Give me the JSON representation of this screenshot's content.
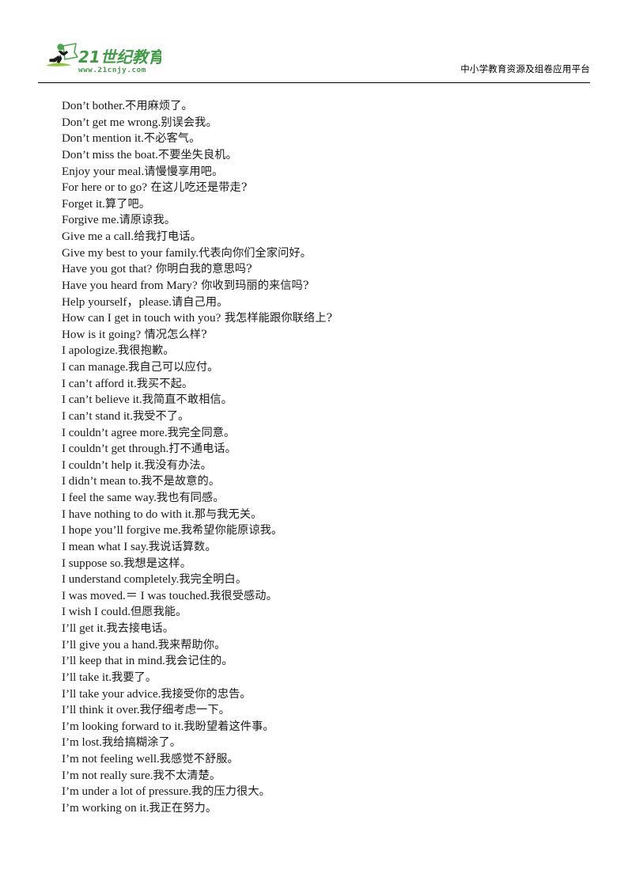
{
  "header": {
    "logo": {
      "icon": "running-person-with-flag-icon",
      "brand_text": "21世纪教育",
      "brand_url": "www.21cnjy.com",
      "green": "#3f9c45",
      "dark_green": "#2e7d33",
      "light_green": "#8cc63f"
    },
    "tagline": "中小学教育资源及组卷应用平台"
  },
  "content": {
    "lines": [
      {
        "en": "Don’t bother.",
        "zh": "不用麻烦了。"
      },
      {
        "en": "Don’t get me wrong.",
        "zh": "别误会我。"
      },
      {
        "en": "Don’t mention it.",
        "zh": "不必客气。"
      },
      {
        "en": "Don’t miss the boat.",
        "zh": "不要坐失良机。"
      },
      {
        "en": "Enjoy your meal.",
        "zh": "请慢慢享用吧。"
      },
      {
        "en": "For here or to go?",
        "zh": " 在这儿吃还是带走?"
      },
      {
        "en": "Forget it.",
        "zh": "算了吧。"
      },
      {
        "en": "Forgive me.",
        "zh": "请原谅我。"
      },
      {
        "en": "Give me a call.",
        "zh": "给我打电话。"
      },
      {
        "en": "Give my best to your family.",
        "zh": "代表向你们全家问好。"
      },
      {
        "en": "Have you got that?",
        "zh": " 你明白我的意思吗?"
      },
      {
        "en": "Have you heard from Mary?",
        "zh": " 你收到玛丽的来信吗?"
      },
      {
        "en": "Help yourself，please.",
        "zh": "请自己用。"
      },
      {
        "en": "How can I get in touch with you?",
        "zh": " 我怎样能跟你联络上?"
      },
      {
        "en": "How is it going?",
        "zh": " 情况怎么样?"
      },
      {
        "en": "I apologize.",
        "zh": "我很抱歉。"
      },
      {
        "en": "I can manage.",
        "zh": "我自己可以应付。"
      },
      {
        "en": "I can’t afford it.",
        "zh": "我买不起。"
      },
      {
        "en": "I can’t believe it.",
        "zh": "我简直不敢相信。"
      },
      {
        "en": "I can’t stand it.",
        "zh": "我受不了。"
      },
      {
        "en": "I couldn’t agree more.",
        "zh": "我完全同意。"
      },
      {
        "en": "I couldn’t get through.",
        "zh": "打不通电话。"
      },
      {
        "en": "I couldn’t help it.",
        "zh": "我没有办法。"
      },
      {
        "en": "I didn’t mean to.",
        "zh": "我不是故意的。"
      },
      {
        "en": "I feel the same way.",
        "zh": "我也有同感。"
      },
      {
        "en": "I have nothing to do with it.",
        "zh": "那与我无关。"
      },
      {
        "en": "I hope you’ll forgive me.",
        "zh": "我希望你能原谅我。"
      },
      {
        "en": "I mean what I say.",
        "zh": "我说话算数。"
      },
      {
        "en": "I suppose so.",
        "zh": "我想是这样。"
      },
      {
        "en": "I understand completely.",
        "zh": "我完全明白。"
      },
      {
        "en": "I was moved.＝ I was touched.",
        "zh": "我很受感动。"
      },
      {
        "en": "I wish I could.",
        "zh": "但愿我能。"
      },
      {
        "en": "I’ll get it.",
        "zh": "我去接电话。"
      },
      {
        "en": "I’ll give you a hand.",
        "zh": "我来帮助你。"
      },
      {
        "en": "I’ll keep that in mind.",
        "zh": "我会记住的。"
      },
      {
        "en": "I’ll take it.",
        "zh": "我要了。"
      },
      {
        "en": "I’ll take your advice.",
        "zh": "我接受你的忠告。"
      },
      {
        "en": "I’ll think it over.",
        "zh": "我仔细考虑一下。"
      },
      {
        "en": "I’m looking forward to it.",
        "zh": "我盼望着这件事。"
      },
      {
        "en": "I’m lost.",
        "zh": "我给搞糊涂了。"
      },
      {
        "en": "I’m not feeling well.",
        "zh": "我感觉不舒服。"
      },
      {
        "en": "I’m not really sure.",
        "zh": "我不太清楚。"
      },
      {
        "en": "I’m under a lot of pressure.",
        "zh": "我的压力很大。"
      },
      {
        "en": "I’m working on it.",
        "zh": "我正在努力。"
      }
    ]
  }
}
